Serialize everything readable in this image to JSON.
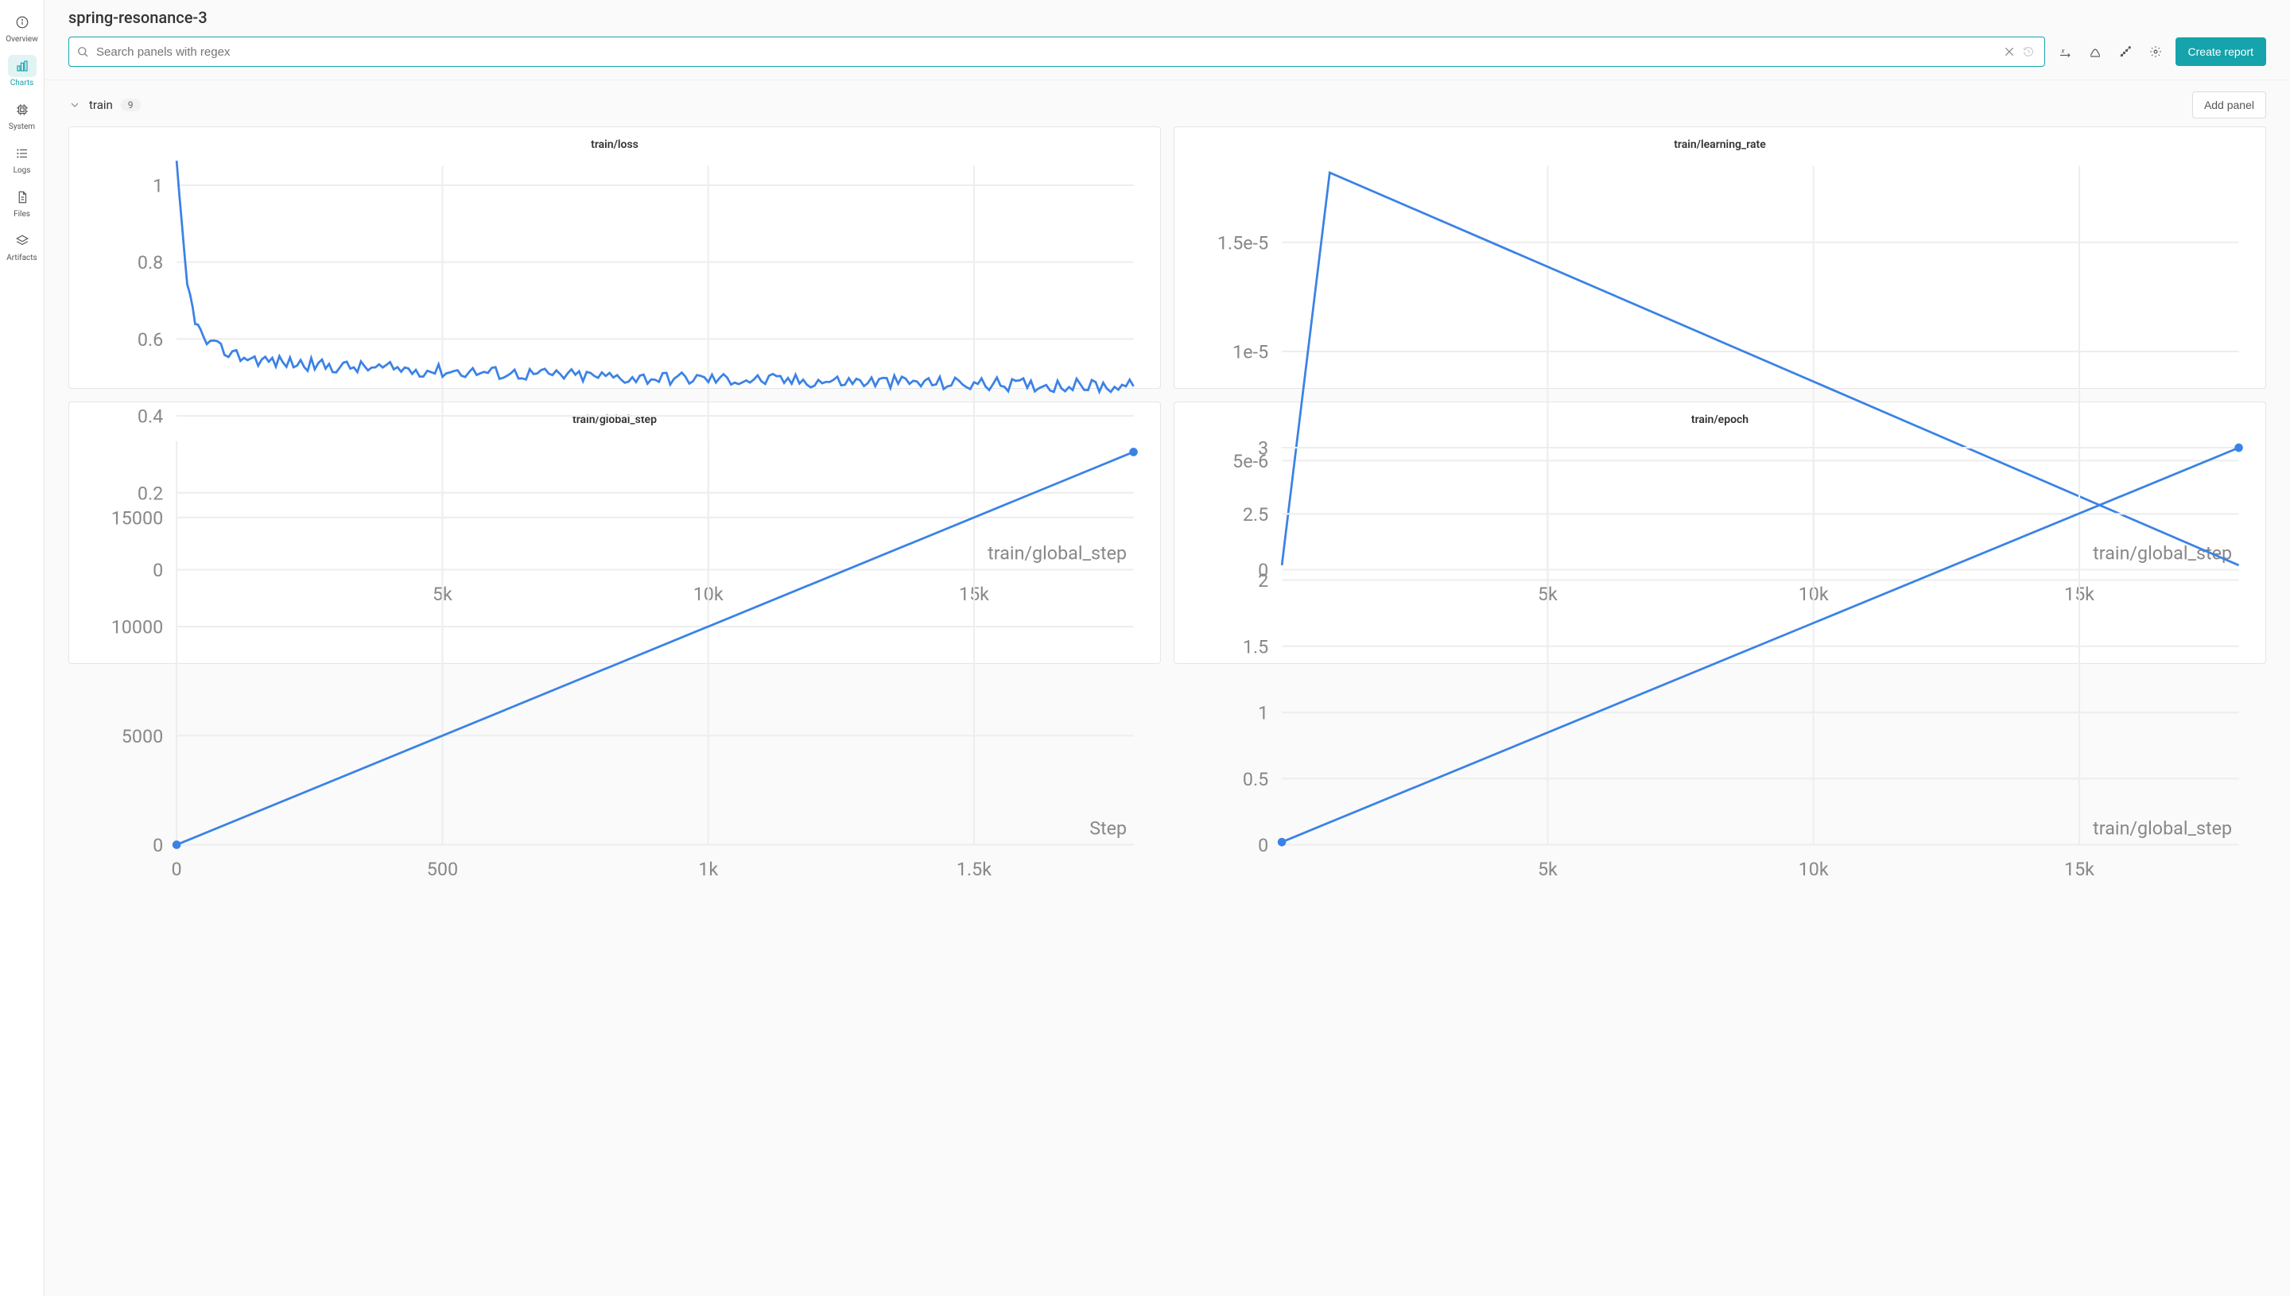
{
  "run_title": "spring-resonance-3",
  "sidebar": {
    "items": [
      {
        "label": "Overview",
        "id": "overview"
      },
      {
        "label": "Charts",
        "id": "charts",
        "active": true
      },
      {
        "label": "System",
        "id": "system"
      },
      {
        "label": "Logs",
        "id": "logs"
      },
      {
        "label": "Files",
        "id": "files"
      },
      {
        "label": "Artifacts",
        "id": "artifacts"
      }
    ]
  },
  "toolbar": {
    "search_placeholder": "Search panels with regex",
    "create_report_label": "Create report"
  },
  "section": {
    "name": "train",
    "count": "9",
    "add_panel_label": "Add panel"
  },
  "panels": [
    {
      "title": "train/loss",
      "xlabel": "train/global_step"
    },
    {
      "title": "train/learning_rate",
      "xlabel": "train/global_step"
    },
    {
      "title": "train/global_step",
      "xlabel": "Step"
    },
    {
      "title": "train/epoch",
      "xlabel": "train/global_step"
    }
  ],
  "chart_data": [
    {
      "type": "line",
      "title": "train/loss",
      "xlabel": "train/global_step",
      "ylabel": "",
      "xlim": [
        0,
        18000
      ],
      "ylim": [
        0,
        1.05
      ],
      "x_ticks": [
        {
          "v": 5000,
          "l": "5k"
        },
        {
          "v": 10000,
          "l": "10k"
        },
        {
          "v": 15000,
          "l": "15k"
        }
      ],
      "y_ticks": [
        {
          "v": 0,
          "l": "0"
        },
        {
          "v": 0.2,
          "l": "0.2"
        },
        {
          "v": 0.4,
          "l": "0.4"
        },
        {
          "v": 0.6,
          "l": "0.6"
        },
        {
          "v": 0.8,
          "l": "0.8"
        },
        {
          "v": 1,
          "l": "1"
        }
      ],
      "series": [
        {
          "name": "spring-resonance-3",
          "x": [
            0,
            100,
            200,
            300,
            400,
            500,
            700,
            900,
            1200,
            1600,
            2000,
            2800,
            3600,
            4500,
            5500,
            6500,
            7500,
            8500,
            9500,
            10500,
            11500,
            12500,
            13500,
            14500,
            15500,
            16500,
            17500,
            18000
          ],
          "y": [
            1.05,
            0.88,
            0.74,
            0.68,
            0.63,
            0.6,
            0.58,
            0.57,
            0.555,
            0.545,
            0.54,
            0.53,
            0.525,
            0.52,
            0.515,
            0.51,
            0.505,
            0.5,
            0.498,
            0.495,
            0.492,
            0.49,
            0.488,
            0.485,
            0.482,
            0.48,
            0.478,
            0.477
          ],
          "noise": 0.018
        }
      ]
    },
    {
      "type": "line",
      "title": "train/learning_rate",
      "xlabel": "train/global_step",
      "ylabel": "",
      "xlim": [
        0,
        18000
      ],
      "ylim": [
        0,
        1.85e-05
      ],
      "x_ticks": [
        {
          "v": 5000,
          "l": "5k"
        },
        {
          "v": 10000,
          "l": "10k"
        },
        {
          "v": 15000,
          "l": "15k"
        }
      ],
      "y_ticks": [
        {
          "v": 0,
          "l": "0"
        },
        {
          "v": 5e-06,
          "l": "5e-6"
        },
        {
          "v": 1e-05,
          "l": "1e-5"
        },
        {
          "v": 1.5e-05,
          "l": "1.5e-5"
        }
      ],
      "series": [
        {
          "name": "spring-resonance-3",
          "x": [
            0,
            900,
            18000
          ],
          "y": [
            2e-07,
            1.82e-05,
            2e-07
          ]
        }
      ]
    },
    {
      "type": "line",
      "title": "train/global_step",
      "xlabel": "Step",
      "ylabel": "",
      "xlim": [
        0,
        1800
      ],
      "ylim": [
        0,
        18500
      ],
      "x_ticks": [
        {
          "v": 0,
          "l": "0"
        },
        {
          "v": 500,
          "l": "500"
        },
        {
          "v": 1000,
          "l": "1k"
        },
        {
          "v": 1500,
          "l": "1.5k"
        }
      ],
      "y_ticks": [
        {
          "v": 0,
          "l": "0"
        },
        {
          "v": 5000,
          "l": "5000"
        },
        {
          "v": 10000,
          "l": "10000"
        },
        {
          "v": 15000,
          "l": "15000"
        }
      ],
      "series": [
        {
          "name": "spring-resonance-3",
          "x": [
            0,
            1800
          ],
          "y": [
            0,
            18000
          ],
          "markers": true
        }
      ]
    },
    {
      "type": "line",
      "title": "train/epoch",
      "xlabel": "train/global_step",
      "ylabel": "",
      "xlim": [
        0,
        18000
      ],
      "ylim": [
        0,
        3.05
      ],
      "x_ticks": [
        {
          "v": 5000,
          "l": "5k"
        },
        {
          "v": 10000,
          "l": "10k"
        },
        {
          "v": 15000,
          "l": "15k"
        }
      ],
      "y_ticks": [
        {
          "v": 0,
          "l": "0"
        },
        {
          "v": 0.5,
          "l": "0.5"
        },
        {
          "v": 1,
          "l": "1"
        },
        {
          "v": 1.5,
          "l": "1.5"
        },
        {
          "v": 2,
          "l": "2"
        },
        {
          "v": 2.5,
          "l": "2.5"
        },
        {
          "v": 3,
          "l": "3"
        }
      ],
      "series": [
        {
          "name": "spring-resonance-3",
          "x": [
            0,
            18000
          ],
          "y": [
            0.02,
            3.0
          ],
          "markers": true
        }
      ]
    }
  ]
}
